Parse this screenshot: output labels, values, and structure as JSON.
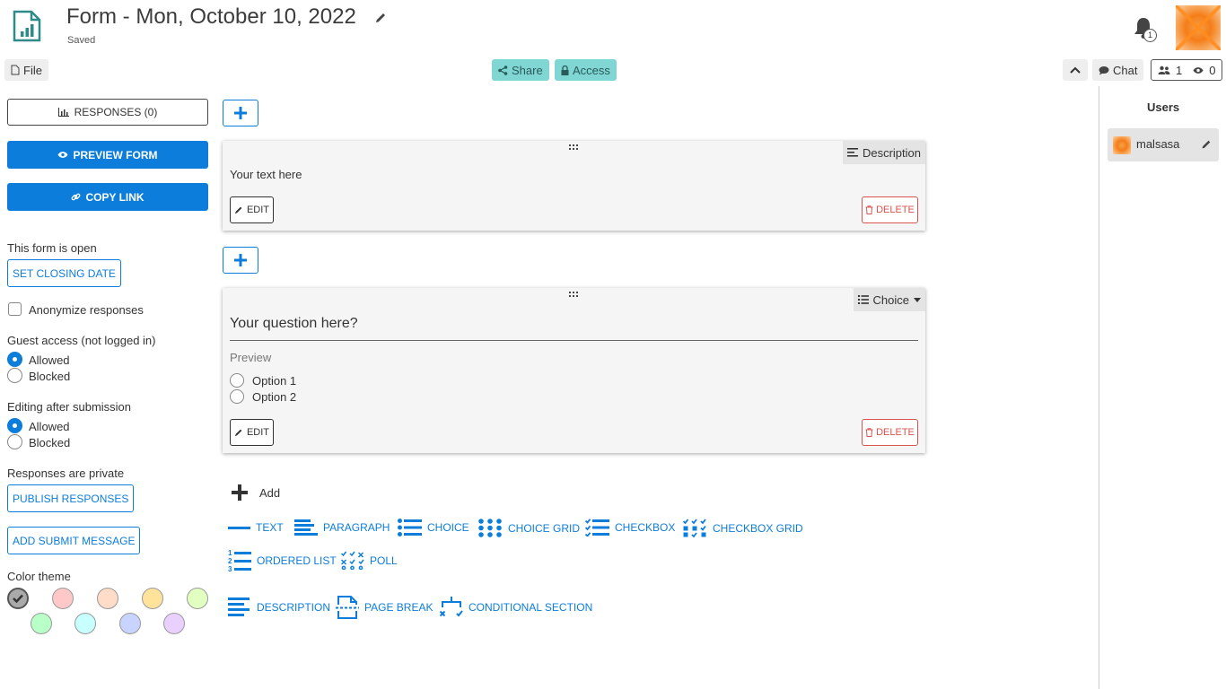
{
  "header": {
    "title": "Form - Mon, October 10, 2022",
    "status": "Saved",
    "notification_count": "1"
  },
  "toolbar": {
    "file_label": "File",
    "share_label": "Share",
    "access_label": "Access",
    "chat_label": "Chat",
    "users_count": "1",
    "viewers_count": "0"
  },
  "sidebar": {
    "responses_label": "RESPONSES (0)",
    "preview_label": "PREVIEW FORM",
    "copy_link_label": "COPY LINK",
    "open_status": "This form is open",
    "set_closing_label": "SET CLOSING DATE",
    "anonymize_label": "Anonymize responses",
    "anonymize_checked": false,
    "guest_access_label": "Guest access (not logged in)",
    "guest_options": [
      "Allowed",
      "Blocked"
    ],
    "guest_selected": "Allowed",
    "editing_label": "Editing after submission",
    "editing_options": [
      "Allowed",
      "Blocked"
    ],
    "editing_selected": "Allowed",
    "privacy_status": "Responses are private",
    "publish_label": "PUBLISH RESPONSES",
    "submit_msg_label": "ADD SUBMIT MESSAGE",
    "color_theme_label": "Color theme",
    "color_swatches": [
      "#aaaaaa",
      "#ffc8c8",
      "#ffdcc8",
      "#ffe39a",
      "#e0ffc0",
      "#b8ffc8",
      "#c8ffff",
      "#c8d4ff",
      "#ead0ff"
    ],
    "selected_swatch": "#aaaaaa"
  },
  "cards": {
    "description": {
      "type_label": "Description",
      "text": "Your text here",
      "edit_label": "EDIT",
      "delete_label": "DELETE"
    },
    "choice": {
      "type_label": "Choice",
      "question": "Your question here?",
      "preview_label": "Preview",
      "options": [
        "Option 1",
        "Option 2"
      ],
      "edit_label": "EDIT",
      "delete_label": "DELETE"
    }
  },
  "add_section": {
    "add_label": "Add",
    "types": [
      "TEXT",
      "PARAGRAPH",
      "CHOICE",
      "CHOICE GRID",
      "CHECKBOX",
      "CHECKBOX GRID",
      "ORDERED LIST",
      "POLL",
      "DESCRIPTION",
      "PAGE BREAK",
      "CONDITIONAL SECTION"
    ]
  },
  "users_panel": {
    "title": "Users",
    "user_name": "malsasa"
  },
  "colors": {
    "accent": "#0c7ddb",
    "teal": "#7fd6d3",
    "danger": "#d9534f"
  }
}
